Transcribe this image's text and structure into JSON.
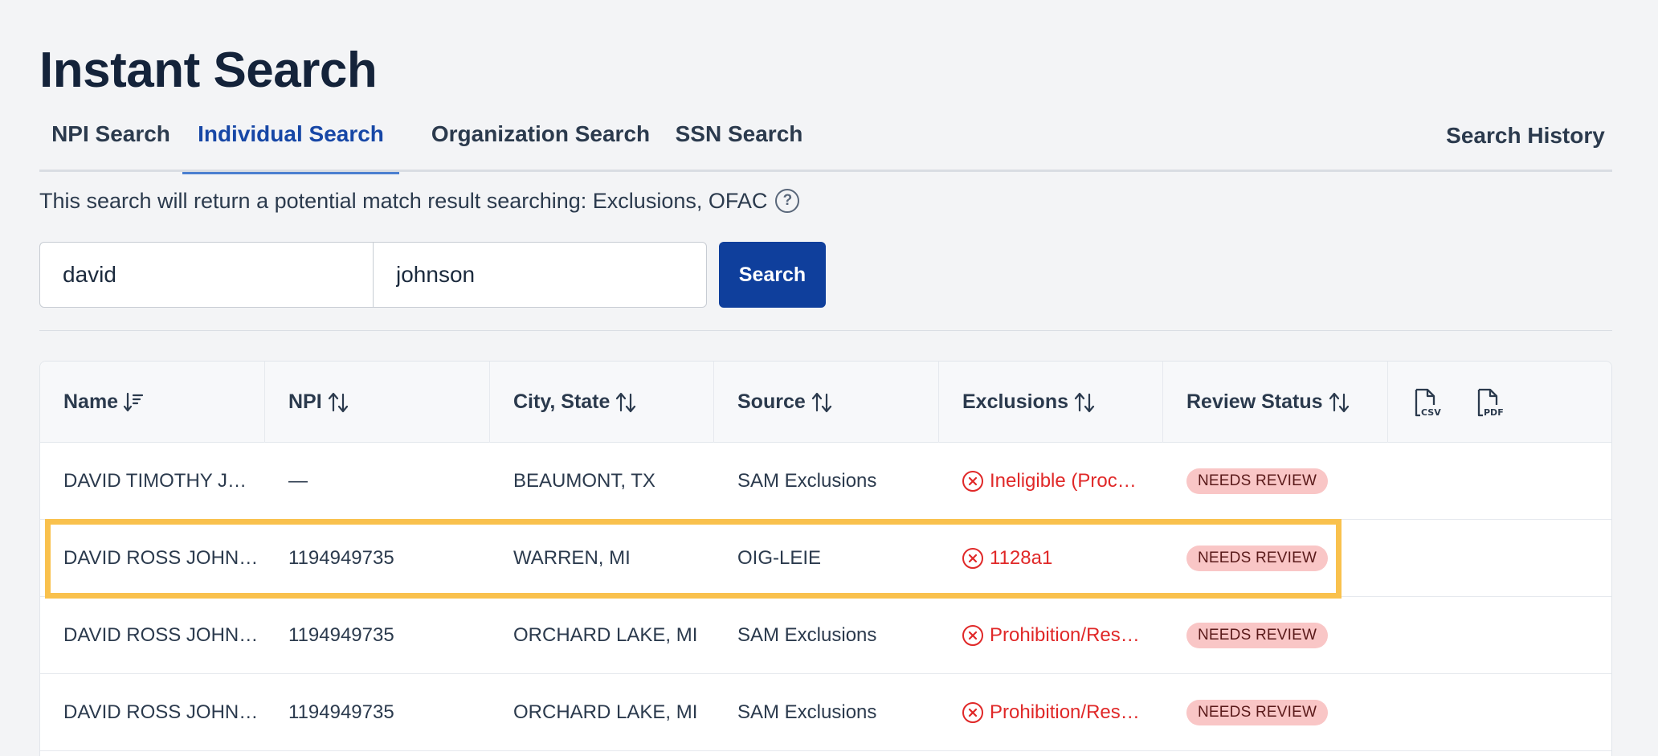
{
  "page_title": "Instant Search",
  "tabs": [
    {
      "label": "NPI Search",
      "active": false
    },
    {
      "label": "Individual Search",
      "active": true
    },
    {
      "label": "Organization Search",
      "active": false
    },
    {
      "label": "SSN Search",
      "active": false
    }
  ],
  "search_history_label": "Search History",
  "description": "This search will return a potential match result searching: Exclusions, OFAC",
  "search": {
    "first_name_value": "david",
    "last_name_value": "johnson",
    "button_label": "Search"
  },
  "table": {
    "columns": [
      "Name",
      "NPI",
      "City, State",
      "Source",
      "Exclusions",
      "Review Status"
    ],
    "export_icons": [
      "csv-icon",
      "pdf-icon"
    ],
    "rows": [
      {
        "name": "DAVID TIMOTHY J…",
        "npi": "—",
        "city_state": "BEAUMONT, TX",
        "source": "SAM Exclusions",
        "exclusion": "Ineligible (Proc…",
        "status": "NEEDS REVIEW"
      },
      {
        "name": "DAVID ROSS JOHN…",
        "npi": "1194949735",
        "city_state": "WARREN, MI",
        "source": "OIG-LEIE",
        "exclusion": "1128a1",
        "status": "NEEDS REVIEW"
      },
      {
        "name": "DAVID ROSS JOHN…",
        "npi": "1194949735",
        "city_state": "ORCHARD LAKE, MI",
        "source": "SAM Exclusions",
        "exclusion": "Prohibition/Res…",
        "status": "NEEDS REVIEW"
      },
      {
        "name": "DAVID ROSS JOHN…",
        "npi": "1194949735",
        "city_state": "ORCHARD LAKE, MI",
        "source": "SAM Exclusions",
        "exclusion": "Prohibition/Res…",
        "status": "NEEDS REVIEW"
      }
    ]
  },
  "colors": {
    "primary": "#0f3f9c",
    "active_tab": "#1747a6",
    "exclusion_red": "#e02828",
    "badge_bg": "#f9c6c6",
    "highlight": "#f9c14d"
  }
}
